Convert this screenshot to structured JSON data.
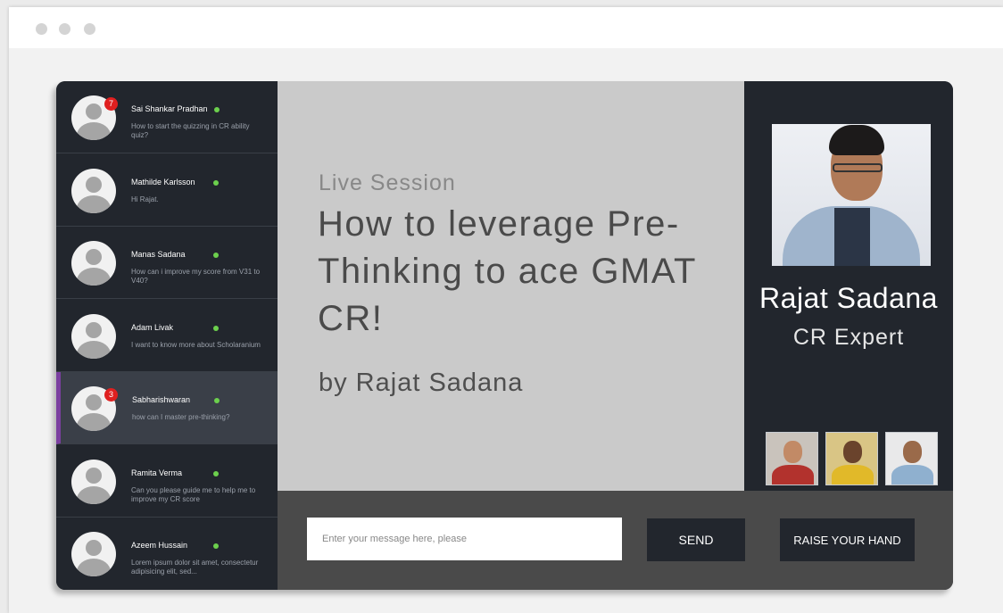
{
  "window": {
    "controls": [
      "dot",
      "dot",
      "dot"
    ]
  },
  "chats": [
    {
      "name": "Sai Shankar Pradhan",
      "message": "How to start the quizzing in CR ability quiz?",
      "badge": "7",
      "online": true,
      "active": false
    },
    {
      "name": "Mathilde Karlsson",
      "message": "Hi Rajat.",
      "badge": "",
      "online": true,
      "active": false
    },
    {
      "name": "Manas Sadana",
      "message": "How can i improve my score from V31 to V40?",
      "badge": "",
      "online": true,
      "active": false
    },
    {
      "name": "Adam Livak",
      "message": "I want to know more about Scholaranium",
      "badge": "",
      "online": true,
      "active": false
    },
    {
      "name": "Sabharishwaran",
      "message": "how can I master pre-thinking?",
      "badge": "3",
      "online": true,
      "active": true
    },
    {
      "name": "Ramita Verma",
      "message": "Can you please guide me to help me to improve my CR score",
      "badge": "",
      "online": true,
      "active": false
    },
    {
      "name": "Azeem Hussain",
      "message": "Lorem ipsum dolor sit amet, consectetur adipisicing elit, sed...",
      "badge": "",
      "online": true,
      "active": false
    }
  ],
  "session": {
    "label": "Live Session",
    "title": "How to leverage Pre-Thinking to ace GMAT CR!",
    "by": "by Rajat Sadana"
  },
  "presenter": {
    "name": "Rajat Sadana",
    "role": "CR Expert"
  },
  "composer": {
    "placeholder": "Enter your message here, please",
    "send_label": "SEND",
    "raise_label": "RAISE YOUR HAND"
  },
  "colors": {
    "sidebar": "#22262d",
    "active_accent": "#7b3fa0",
    "online": "#6cd04d",
    "badge": "#e02020",
    "stage": "#cacaca"
  }
}
